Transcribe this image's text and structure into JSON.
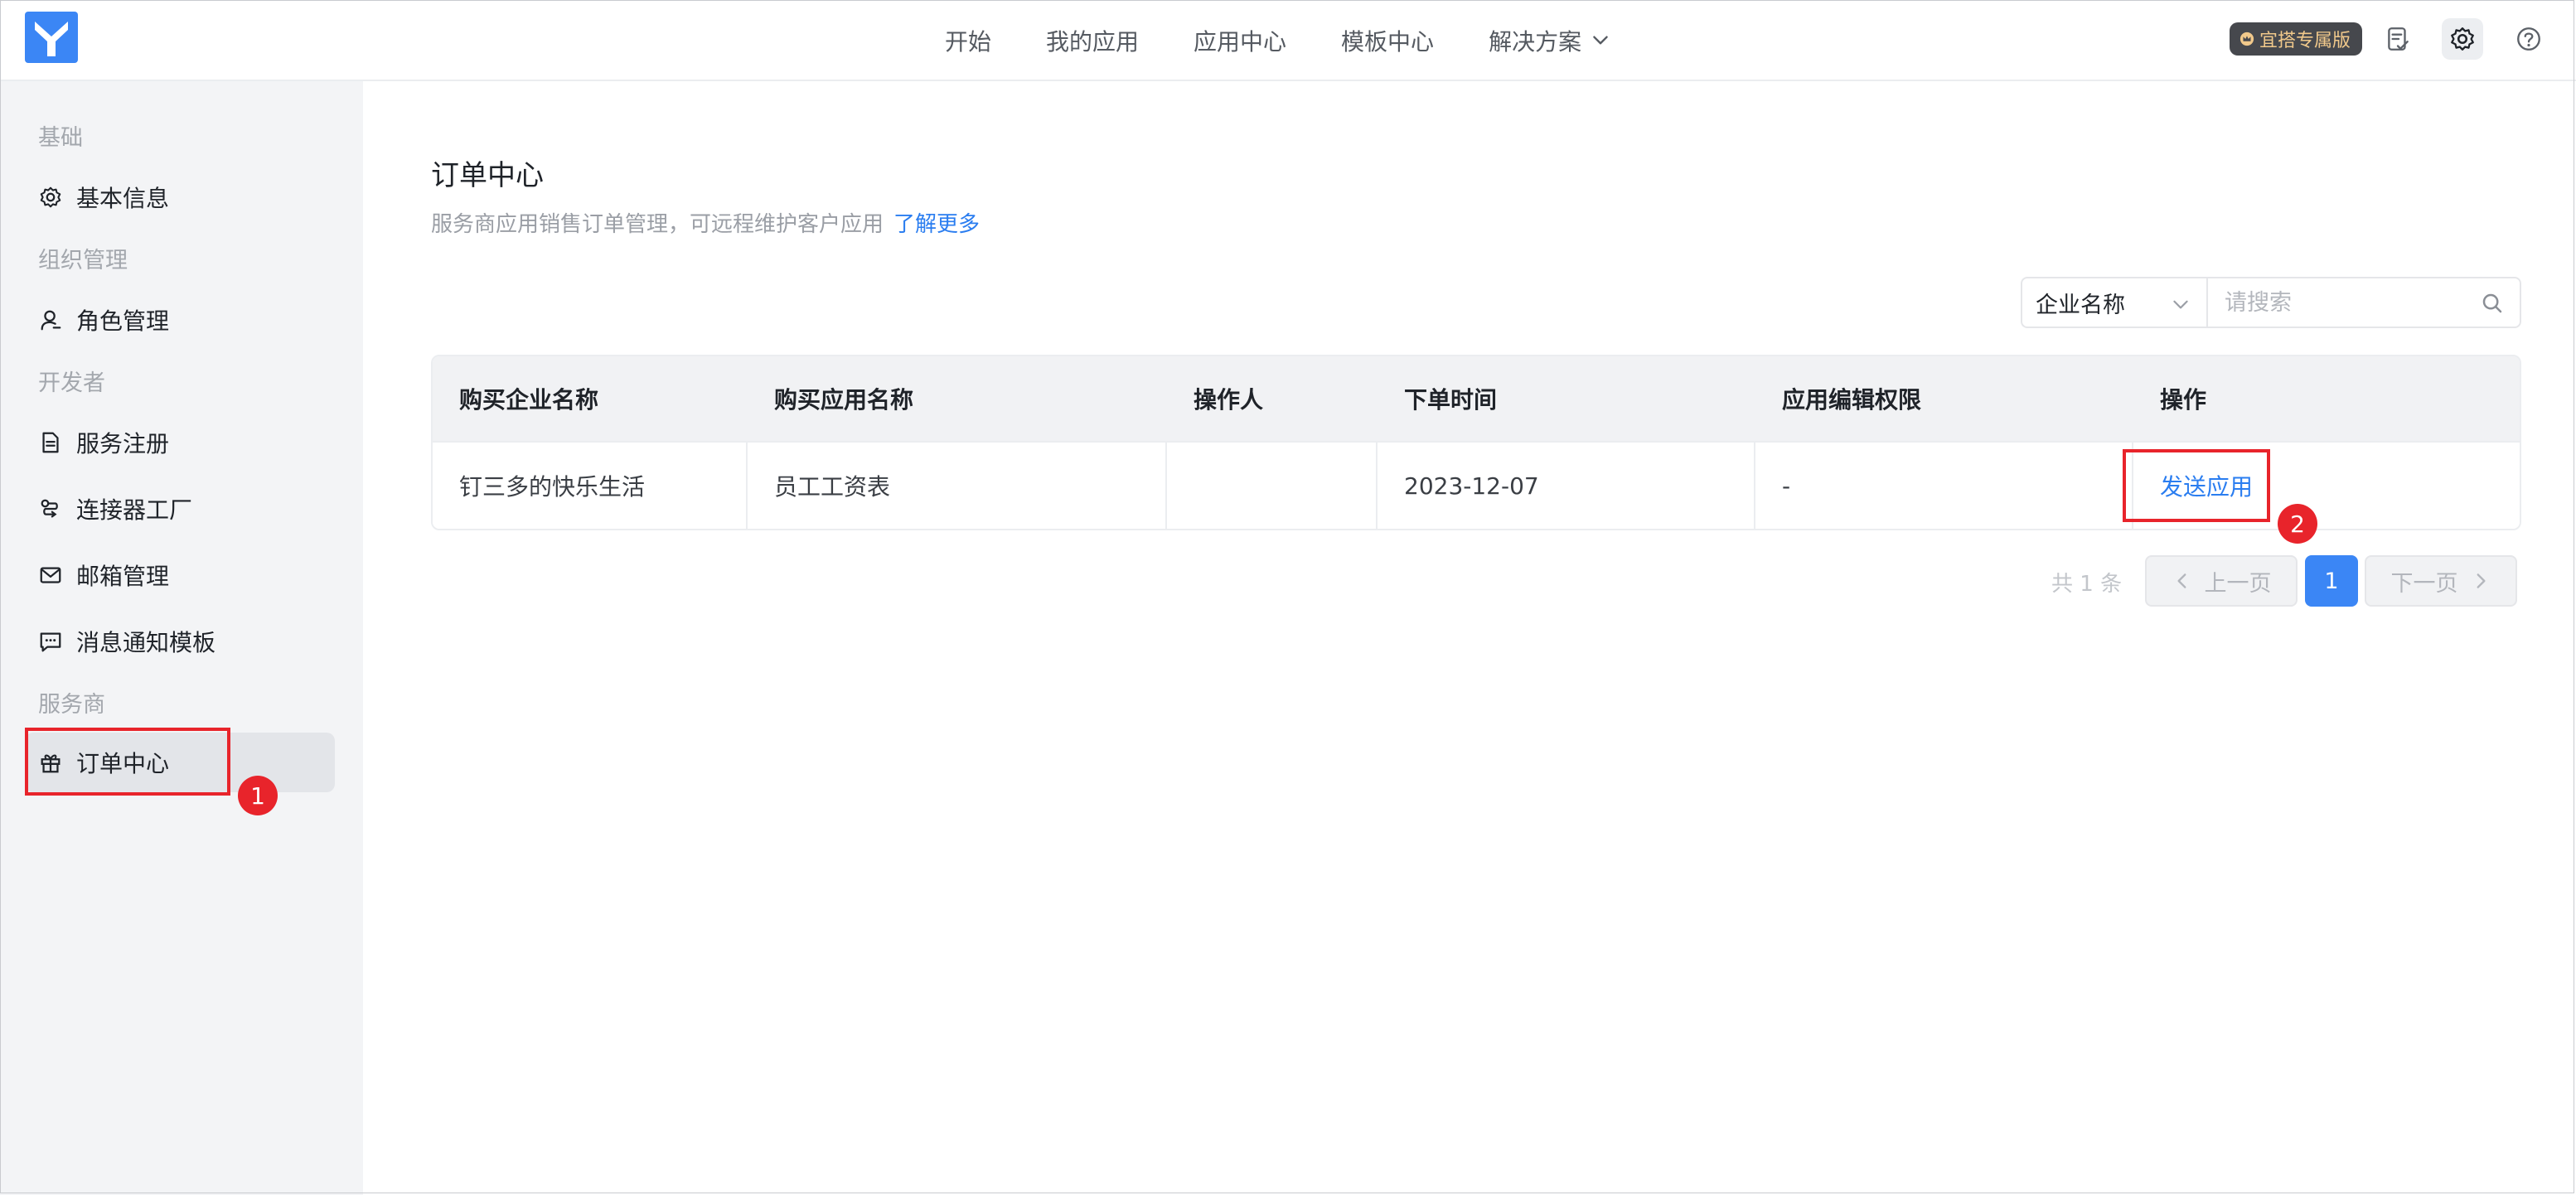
{
  "header": {
    "nav": [
      "开始",
      "我的应用",
      "应用中心",
      "模板中心",
      "解决方案"
    ],
    "badge": "宜搭专属版"
  },
  "sidebar": {
    "groups": [
      "基础",
      "组织管理",
      "开发者",
      "服务商"
    ],
    "items": [
      {
        "label": "基本信息",
        "icon": "gear-icon"
      },
      {
        "label": "角色管理",
        "icon": "user-icon"
      },
      {
        "label": "服务注册",
        "icon": "document-icon"
      },
      {
        "label": "连接器工厂",
        "icon": "connector-icon"
      },
      {
        "label": "邮箱管理",
        "icon": "mail-icon"
      },
      {
        "label": "消息通知模板",
        "icon": "message-icon"
      },
      {
        "label": "订单中心",
        "icon": "gift-icon"
      }
    ]
  },
  "main": {
    "title": "订单中心",
    "description": "服务商应用销售订单管理，可远程维护客户应用",
    "learn_more": "了解更多",
    "filter_select": "企业名称",
    "search_placeholder": "请搜索",
    "table": {
      "headers": [
        "购买企业名称",
        "购买应用名称",
        "操作人",
        "下单时间",
        "应用编辑权限",
        "操作"
      ],
      "rows": [
        {
          "company": "钉三多的快乐生活",
          "app": "员工工资表",
          "operator": "",
          "time": "2023-12-07",
          "permission": "-",
          "action": "发送应用"
        }
      ]
    },
    "pagination": {
      "total": "共 1 条",
      "prev": "上一页",
      "current": "1",
      "next": "下一页"
    }
  },
  "annotations": [
    "1",
    "2"
  ],
  "colors": {
    "accent": "#2a7df0",
    "highlight": "#e8242b",
    "sidebar_bg": "#f3f4f6"
  }
}
